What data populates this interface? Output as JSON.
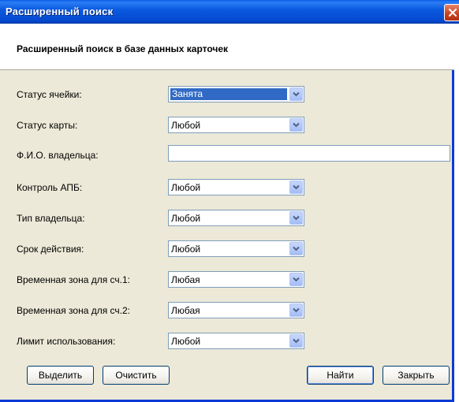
{
  "window": {
    "title": "Расширенный поиск"
  },
  "header": {
    "text": "Расширенный поиск в базе данных карточек"
  },
  "fields": [
    {
      "label": "Статус ячейки:",
      "value": "Занята",
      "selected": true
    },
    {
      "label": "Статус карты:",
      "value": "Любой"
    },
    {
      "label": "Ф.И.О. владельца:",
      "value": ""
    },
    {
      "label": "Контроль АПБ:",
      "value": "Любой"
    },
    {
      "label": "Тип владельца:",
      "value": "Любой"
    },
    {
      "label": "Срок действия:",
      "value": "Любой"
    },
    {
      "label": "Временная зона для сч.1:",
      "value": "Любая"
    },
    {
      "label": "Временная зона для сч.2:",
      "value": "Любая"
    },
    {
      "label": "Лимит использования:",
      "value": "Любой"
    }
  ],
  "buttons": {
    "select": "Выделить",
    "clear": "Очистить",
    "find": "Найти",
    "close": "Закрыть"
  },
  "icons": {
    "close": "close-icon",
    "dropdown": "chevron-down-icon"
  },
  "colors": {
    "titlebar": "#0a5ae0",
    "dialog_bg": "#ece9d8",
    "selection": "#316ac5"
  }
}
